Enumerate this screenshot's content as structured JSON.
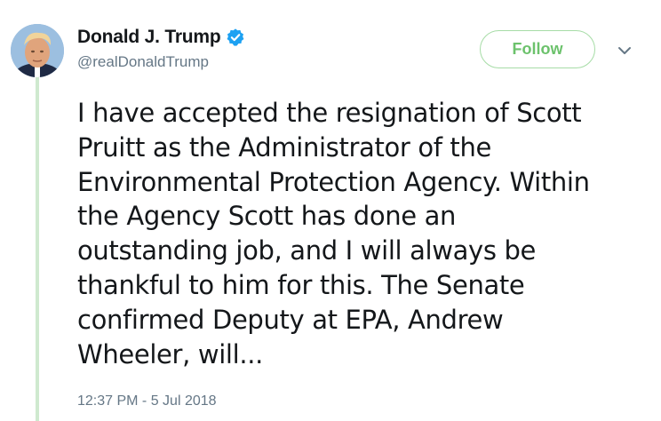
{
  "tweet": {
    "author": {
      "display_name": "Donald J. Trump",
      "handle": "@realDonaldTrump",
      "verified": true,
      "avatar_icon": "profile-photo"
    },
    "follow_label": "Follow",
    "more_menu_icon": "chevron-down-icon",
    "text": "I have accepted the resignation of Scott\nPruitt as the Administrator of the\nEnvironmental Protection Agency. Within\nthe Agency Scott has done an\noutstanding job, and I will always be\nthankful to him for this. The Senate\nconfirmed Deputy at EPA, Andrew\nWheeler, will...",
    "timestamp": "12:37 PM - 5 Jul 2018"
  },
  "colors": {
    "follow_green": "#6cc26c",
    "follow_border": "#a6dca6",
    "thread_line": "#cfe9cf",
    "verified_blue": "#1da1f2",
    "secondary_text": "#657786",
    "primary_text": "#14171a"
  }
}
